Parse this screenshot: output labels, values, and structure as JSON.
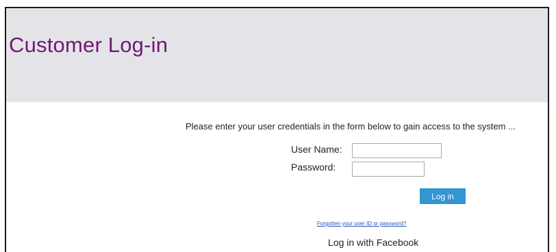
{
  "header": {
    "title": "Customer Log-in"
  },
  "form": {
    "intro_text": "Please enter your user credentials in the form below to gain access to the system ...",
    "username_label": "User Name:",
    "username_value": "",
    "password_label": "Password:",
    "password_value": "",
    "login_button_label": "Log in",
    "forgot_link_text": "Forgotten your user ID or password?",
    "facebook_login_text": "Log in with Facebook"
  },
  "colors": {
    "title": "#6e1a73",
    "header_bg": "#e4e4e8",
    "button_bg": "#3296d2",
    "link": "#2a52be"
  }
}
